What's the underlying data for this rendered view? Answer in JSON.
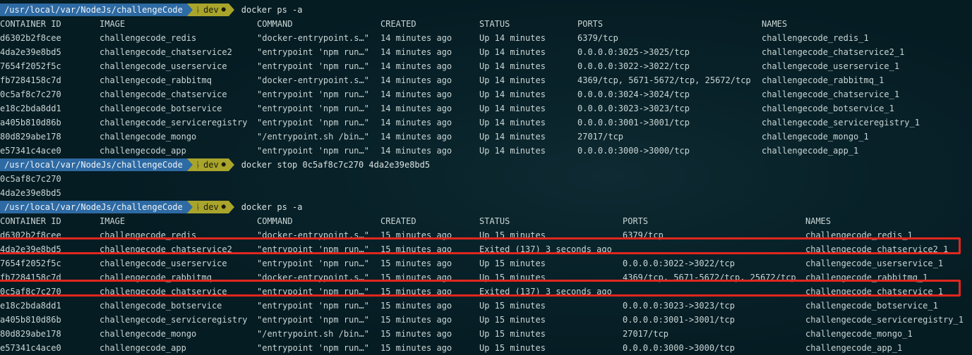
{
  "prompt": {
    "path": "/usr/local/var/NodeJs/challengeCode",
    "branch_icon": "git-branch-icon",
    "branch": "dev",
    "dirty_marker": "●"
  },
  "commands": [
    "docker ps -a",
    "docker stop 0c5af8c7c270 4da2e39e8bd5",
    "docker ps -a"
  ],
  "headers": {
    "container_id": "CONTAINER ID",
    "image": "IMAGE",
    "command": "COMMAND",
    "created": "CREATED",
    "status": "STATUS",
    "ports": "PORTS",
    "names": "NAMES"
  },
  "table1": [
    [
      "d6302b2f8cee",
      "challengecode_redis",
      "\"docker-entrypoint.s…\"",
      "14 minutes ago",
      "Up 14 minutes",
      "6379/tcp",
      "challengecode_redis_1"
    ],
    [
      "4da2e39e8bd5",
      "challengecode_chatservice2",
      "\"entrypoint 'npm run…\"",
      "14 minutes ago",
      "Up 14 minutes",
      "0.0.0.0:3025->3025/tcp",
      "challengecode_chatservice2_1"
    ],
    [
      "7654f2052f5c",
      "challengecode_userservice",
      "\"entrypoint 'npm run…\"",
      "14 minutes ago",
      "Up 14 minutes",
      "0.0.0.0:3022->3022/tcp",
      "challengecode_userservice_1"
    ],
    [
      "fb7284158c7d",
      "challengecode_rabbitmq",
      "\"docker-entrypoint.s…\"",
      "14 minutes ago",
      "Up 14 minutes",
      "4369/tcp, 5671-5672/tcp, 25672/tcp",
      "challengecode_rabbitmq_1"
    ],
    [
      "0c5af8c7c270",
      "challengecode_chatservice",
      "\"entrypoint 'npm run…\"",
      "14 minutes ago",
      "Up 14 minutes",
      "0.0.0.0:3024->3024/tcp",
      "challengecode_chatservice_1"
    ],
    [
      "e18c2bda8dd1",
      "challengecode_botservice",
      "\"entrypoint 'npm run…\"",
      "14 minutes ago",
      "Up 14 minutes",
      "0.0.0.0:3023->3023/tcp",
      "challengecode_botservice_1"
    ],
    [
      "a405b810d86b",
      "challengecode_serviceregistry",
      "\"entrypoint 'npm run…\"",
      "14 minutes ago",
      "Up 14 minutes",
      "0.0.0.0:3001->3001/tcp",
      "challengecode_serviceregistry_1"
    ],
    [
      "80d829abe178",
      "challengecode_mongo",
      "\"/entrypoint.sh /bin…\"",
      "14 minutes ago",
      "Up 14 minutes",
      "27017/tcp",
      "challengecode_mongo_1"
    ],
    [
      "e57341c4ace0",
      "challengecode_app",
      "\"entrypoint 'npm run…\"",
      "14 minutes ago",
      "Up 14 minutes",
      "0.0.0.0:3000->3000/tcp",
      "challengecode_app_1"
    ]
  ],
  "stop_output": [
    "0c5af8c7c270",
    "4da2e39e8bd5"
  ],
  "table2": [
    [
      "d6302b2f8cee",
      "challengecode_redis",
      "\"docker-entrypoint.s…\"",
      "15 minutes ago",
      "Up 15 minutes",
      "6379/tcp",
      "challengecode_redis_1"
    ],
    [
      "4da2e39e8bd5",
      "challengecode_chatservice2",
      "\"entrypoint 'npm run…\"",
      "15 minutes ago",
      "Exited (137) 3 seconds ago",
      "",
      "challengecode_chatservice2_1"
    ],
    [
      "7654f2052f5c",
      "challengecode_userservice",
      "\"entrypoint 'npm run…\"",
      "15 minutes ago",
      "Up 15 minutes",
      "0.0.0.0:3022->3022/tcp",
      "challengecode_userservice_1"
    ],
    [
      "fb7284158c7d",
      "challengecode_rabbitmq",
      "\"docker-entrypoint.s…\"",
      "15 minutes ago",
      "Up 15 minutes",
      "4369/tcp, 5671-5672/tcp, 25672/tcp",
      "challengecode_rabbitmq_1"
    ],
    [
      "0c5af8c7c270",
      "challengecode_chatservice",
      "\"entrypoint 'npm run…\"",
      "15 minutes ago",
      "Exited (137) 3 seconds ago",
      "",
      "challengecode_chatservice_1"
    ],
    [
      "e18c2bda8dd1",
      "challengecode_botservice",
      "\"entrypoint 'npm run…\"",
      "15 minutes ago",
      "Up 15 minutes",
      "0.0.0.0:3023->3023/tcp",
      "challengecode_botservice_1"
    ],
    [
      "a405b810d86b",
      "challengecode_serviceregistry",
      "\"entrypoint 'npm run…\"",
      "15 minutes ago",
      "Up 15 minutes",
      "0.0.0.0:3001->3001/tcp",
      "challengecode_serviceregistry_1"
    ],
    [
      "80d829abe178",
      "challengecode_mongo",
      "\"/entrypoint.sh /bin…\"",
      "15 minutes ago",
      "Up 15 minutes",
      "27017/tcp",
      "challengecode_mongo_1"
    ],
    [
      "e57341c4ace0",
      "challengecode_app",
      "\"entrypoint 'npm run…\"",
      "15 minutes ago",
      "Up 15 minutes",
      "0.0.0.0:3000->3000/tcp",
      "challengecode_app_1"
    ]
  ],
  "highlight_color": "#e0271e",
  "highlighted_rows": [
    1,
    4
  ]
}
